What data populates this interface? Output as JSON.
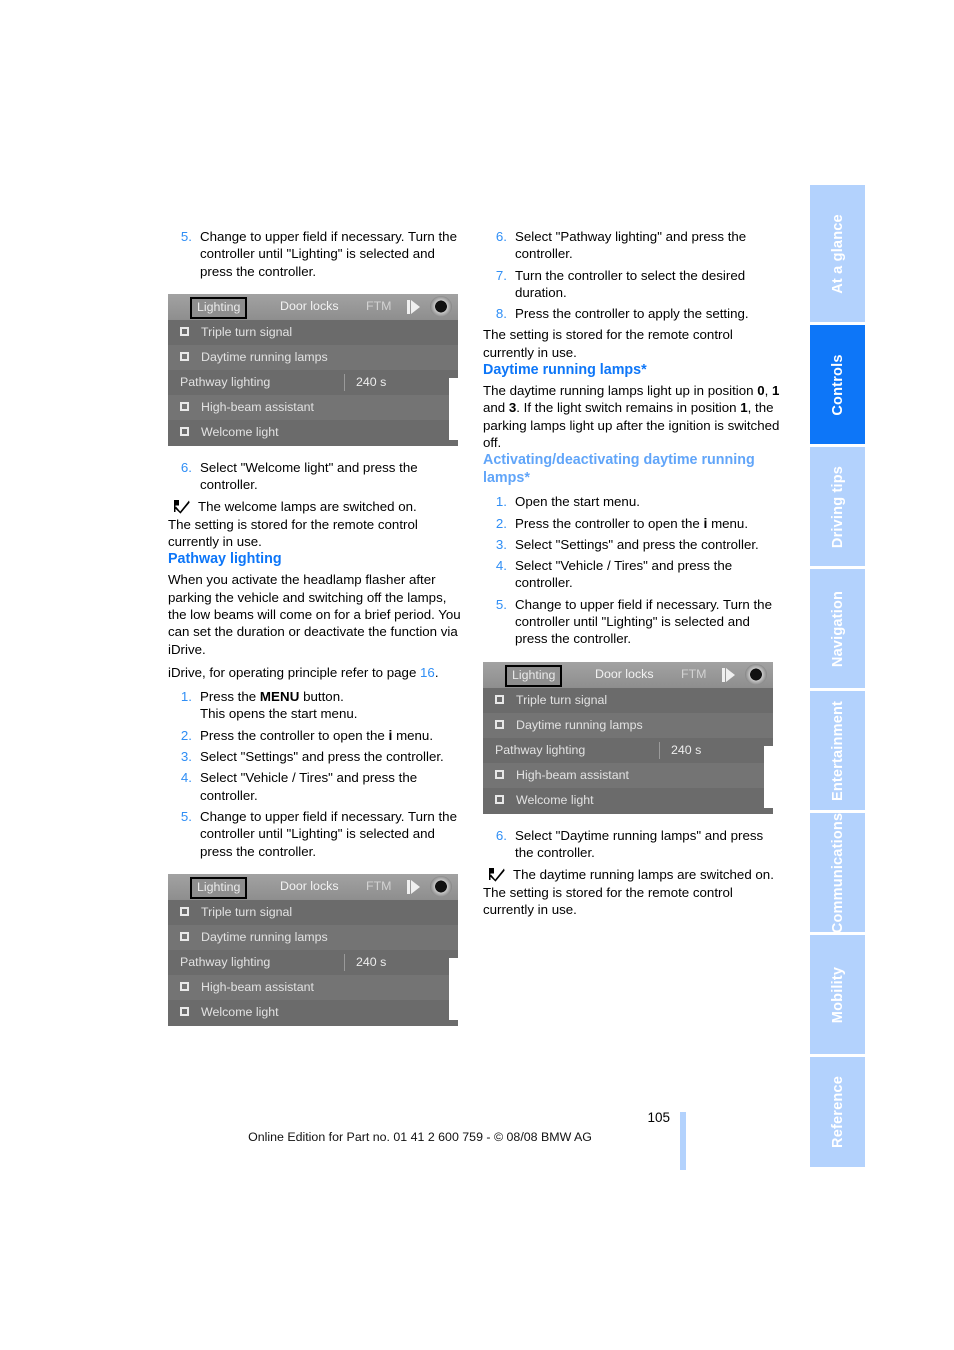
{
  "document": {
    "page_number": "105",
    "edition_line": "Online Edition for Part no. 01 41 2 600 759 - © 08/08 BMW AG"
  },
  "sidebar": {
    "tabs": [
      {
        "label": "At a glance",
        "active": false
      },
      {
        "label": "Controls",
        "active": true
      },
      {
        "label": "Driving tips",
        "active": false
      },
      {
        "label": "Navigation",
        "active": false
      },
      {
        "label": "Entertainment",
        "active": false
      },
      {
        "label": "Communications",
        "active": false
      },
      {
        "label": "Mobility",
        "active": false
      },
      {
        "label": "Reference",
        "active": false
      }
    ],
    "colors": {
      "active_bg": "#0d76f8",
      "inactive_bg": "#b3d2fd",
      "label": "#ffffff"
    }
  },
  "colors": {
    "heading_blue": "#0d76f8",
    "heading_blue_light": "#61a5f9",
    "list_number_blue": "#2f8ef5",
    "link_blue": "#2f8ef5"
  },
  "left_column": {
    "step5": {
      "num": "5.",
      "text": "Change to upper field if necessary. Turn the controller until \"Lighting\" is selected and press the controller."
    },
    "figure1": {
      "tabs": [
        "Lighting",
        "Door locks",
        "FTM"
      ],
      "selected_tab": "Lighting",
      "rows": [
        {
          "label": "Triple turn signal",
          "checkbox": true,
          "value": ""
        },
        {
          "label": "Daytime running lamps",
          "checkbox": true,
          "value": ""
        },
        {
          "label": "Pathway lighting",
          "checkbox": false,
          "value": "240 s"
        },
        {
          "label": "High-beam assistant",
          "checkbox": true,
          "value": ""
        },
        {
          "label": "Welcome light",
          "checkbox": true,
          "value": ""
        }
      ]
    },
    "step6": {
      "num": "6.",
      "text": "Select \"Welcome light\" and press the controller."
    },
    "result1": "The welcome lamps are switched on.",
    "stored1": "The setting is stored for the remote control currently in use.",
    "heading_pathway": "Pathway lighting",
    "pathway_body": "When you activate the headlamp flasher after parking the vehicle and switching off the lamps, the low beams will come on for a brief period. You can set the duration or deactivate the function via iDrive.",
    "idrive_ref_pre": "iDrive, for operating principle refer to page ",
    "idrive_ref_page": "16",
    "idrive_ref_post": ".",
    "steps": [
      {
        "num": "1.",
        "pre": "Press the ",
        "bold": "MENU",
        "post": " button.",
        "second_line": "This opens the start menu."
      },
      {
        "num": "2.",
        "pre": "Press the controller to open the ",
        "bold": "i",
        "post": " menu.",
        "second_line": ""
      },
      {
        "num": "3.",
        "pre": "Select \"Settings\" and press the controller.",
        "bold": "",
        "post": "",
        "second_line": ""
      },
      {
        "num": "4.",
        "pre": "Select \"Vehicle / Tires\" and press the controller.",
        "bold": "",
        "post": "",
        "second_line": ""
      },
      {
        "num": "5.",
        "pre": "Change to upper field if necessary. Turn the controller until \"Lighting\" is selected and press the controller.",
        "bold": "",
        "post": "",
        "second_line": ""
      }
    ],
    "figure2": {
      "tabs": [
        "Lighting",
        "Door locks",
        "FTM"
      ],
      "selected_tab": "Lighting",
      "rows": [
        {
          "label": "Triple turn signal",
          "checkbox": true,
          "value": ""
        },
        {
          "label": "Daytime running lamps",
          "checkbox": true,
          "value": ""
        },
        {
          "label": "Pathway lighting",
          "checkbox": false,
          "value": "240 s"
        },
        {
          "label": "High-beam assistant",
          "checkbox": true,
          "value": ""
        },
        {
          "label": "Welcome light",
          "checkbox": true,
          "value": ""
        }
      ]
    }
  },
  "right_column": {
    "steps_top": [
      {
        "num": "6.",
        "text": "Select \"Pathway lighting\" and press the controller."
      },
      {
        "num": "7.",
        "text": "Turn the controller to select the desired duration."
      },
      {
        "num": "8.",
        "text": "Press the controller to apply the setting."
      }
    ],
    "stored1": "The setting is stored for the remote control currently in use.",
    "heading_drl": "Daytime running lamps*",
    "drl_body_1": "The daytime running lamps light up in position ",
    "drl_pos_0": "0",
    "drl_body_2": ", ",
    "drl_pos_1": "1",
    "drl_body_3": " and ",
    "drl_pos_3": "3",
    "drl_body_4": ". If the light switch remains in position ",
    "drl_pos_1b": "1",
    "drl_body_5": ", the parking lamps light up after the ignition is switched off.",
    "heading_activate": "Activating/deactivating daytime running lamps*",
    "steps": [
      {
        "num": "1.",
        "pre": "Open the start menu.",
        "bold": "",
        "post": ""
      },
      {
        "num": "2.",
        "pre": "Press the controller to open the ",
        "bold": "i",
        "post": " menu."
      },
      {
        "num": "3.",
        "pre": "Select \"Settings\" and press the controller.",
        "bold": "",
        "post": ""
      },
      {
        "num": "4.",
        "pre": "Select \"Vehicle / Tires\" and press the controller.",
        "bold": "",
        "post": ""
      },
      {
        "num": "5.",
        "pre": "Change to upper field if necessary. Turn the controller until \"Lighting\" is selected and press the controller.",
        "bold": "",
        "post": ""
      }
    ],
    "figure3": {
      "tabs": [
        "Lighting",
        "Door locks",
        "FTM"
      ],
      "selected_tab": "Lighting",
      "rows": [
        {
          "label": "Triple turn signal",
          "checkbox": true,
          "value": ""
        },
        {
          "label": "Daytime running lamps",
          "checkbox": true,
          "value": ""
        },
        {
          "label": "Pathway lighting",
          "checkbox": false,
          "value": "240 s"
        },
        {
          "label": "High-beam assistant",
          "checkbox": true,
          "value": ""
        },
        {
          "label": "Welcome light",
          "checkbox": true,
          "value": ""
        }
      ]
    },
    "step6": {
      "num": "6.",
      "text": "Select \"Daytime running lamps\" and press the controller."
    },
    "result1": "The daytime running lamps are switched on.",
    "stored2": "The setting is stored for the remote control currently in use."
  }
}
